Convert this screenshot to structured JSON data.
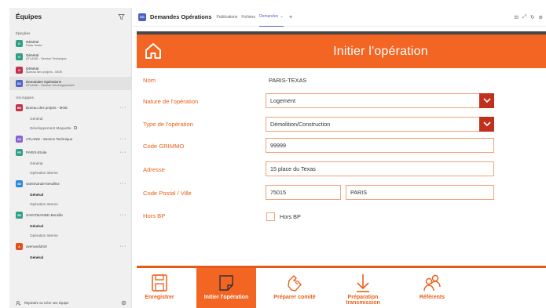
{
  "sidebar": {
    "title": "Équipes",
    "pinned_heading": "Épinglées",
    "pinned": [
      {
        "tile": "G",
        "tile_color": "#2f9f86",
        "name": "Général",
        "sub": "Paris Voute"
      },
      {
        "tile": "G",
        "tile_color": "#2f9f86",
        "name": "Général",
        "sub": "ATLAND - Service Technique"
      },
      {
        "tile": "G",
        "tile_color": "#c4314b",
        "name": "Général",
        "sub": "Bureau des projets - MOE"
      },
      {
        "tile": "DO",
        "tile_color": "#4a63c7",
        "name": "Demandes Opérations",
        "sub": "ATLAND - Service Développement"
      }
    ],
    "teams_heading": "Vos équipes",
    "teams": [
      {
        "tile": "BM",
        "tile_color": "#c4314b",
        "name": "Bureau des projets - MOE",
        "channels": [
          {
            "label": "Général",
            "bold": false
          },
          {
            "label": "Développement Maquette",
            "bold": false
          }
        ]
      },
      {
        "tile": "AS",
        "tile_color": "#8a63d2",
        "name": "ATLAND - Service Technique",
        "channels": []
      },
      {
        "tile": "PE",
        "tile_color": "#2f9f86",
        "name": "PARIS-Etoile",
        "channels": [
          {
            "label": "Général",
            "bold": false
          },
          {
            "label": "Opération Interne",
            "bold": false
          }
        ]
      },
      {
        "tile": "SB",
        "tile_color": "#2b88d8",
        "name": "saintmande-beruille2",
        "channels": [
          {
            "label": "Général",
            "bold": true
          },
          {
            "label": "Opération Interne",
            "bold": false
          }
        ]
      },
      {
        "tile": "SB",
        "tile_color": "#2f9f86",
        "name": "SAINTMANDE-Beruille",
        "channels": [
          {
            "label": "Général",
            "bold": true
          },
          {
            "label": "Opération Interne",
            "bold": false
          }
        ]
      },
      {
        "tile": "A",
        "tile_color": "#e3501a",
        "name": "avenuedufort",
        "channels": [
          {
            "label": "Général",
            "bold": true
          }
        ]
      }
    ],
    "join_label": "Rejoindre ou créer une équipe"
  },
  "topbar": {
    "app_tile": "DO",
    "title": "Demandes Opérations",
    "tabs": [
      "Publications",
      "Fichiers",
      "Demandes"
    ],
    "active_tab": "Demandes"
  },
  "app": {
    "header_title": "Initier l'opération",
    "fields": {
      "nom_label": "Nom",
      "nom_value": "PARIS-TEXAS",
      "nature_label": "Nature de l'opération",
      "nature_value": "Logement",
      "type_label": "Type de l'opération",
      "type_value": "Démolition/Construction",
      "grimmo_label": "Code GRIMMO",
      "grimmo_value": "99999",
      "adresse_label": "Adresse",
      "adresse_value": "15 place du Texas",
      "cp_label": "Code Postal / Ville",
      "cp_value": "75015",
      "ville_value": "PARIS",
      "horsbp_label": "Hors BP",
      "horsbp_check_label": "Hors BP",
      "horsbp_checked": false
    },
    "toolbar": [
      {
        "label": "Enregistrer",
        "icon": "save-icon",
        "active": false
      },
      {
        "label": "Initier l'opération",
        "icon": "note-icon",
        "active": true
      },
      {
        "label": "Préparer comité",
        "icon": "hand-icon",
        "active": false
      },
      {
        "label": "Préparation transmission",
        "icon": "download-arrow-icon",
        "active": false
      },
      {
        "label": "Référents",
        "icon": "people-icon",
        "active": false
      }
    ]
  },
  "colors": {
    "accent": "#f26522",
    "dropdown": "#c0301c",
    "teams_purple": "#5b5fc7"
  }
}
